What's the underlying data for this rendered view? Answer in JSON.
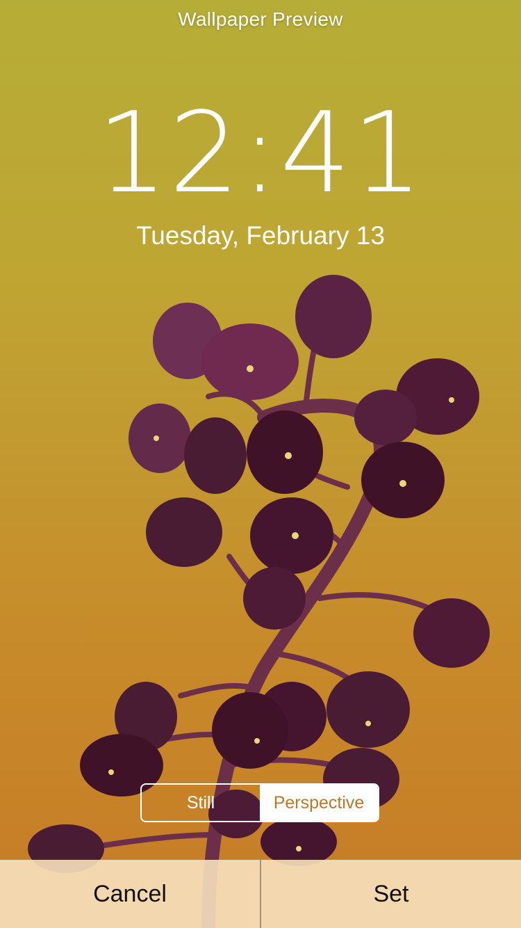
{
  "header": {
    "title": "Wallpaper Preview"
  },
  "lockscreen": {
    "time": "12:41",
    "date": "Tuesday, February 13"
  },
  "mode_selector": {
    "options": [
      {
        "label": "Still",
        "selected": false
      },
      {
        "label": "Perspective",
        "selected": true
      }
    ]
  },
  "actions": {
    "cancel_label": "Cancel",
    "set_label": "Set"
  },
  "wallpaper": {
    "subject": "flower-stem-illustration"
  },
  "colors": {
    "accent": "#b8792b",
    "flower": "#4a1c33",
    "background_top": "#b5ad37",
    "background_bottom": "#c77b26"
  }
}
